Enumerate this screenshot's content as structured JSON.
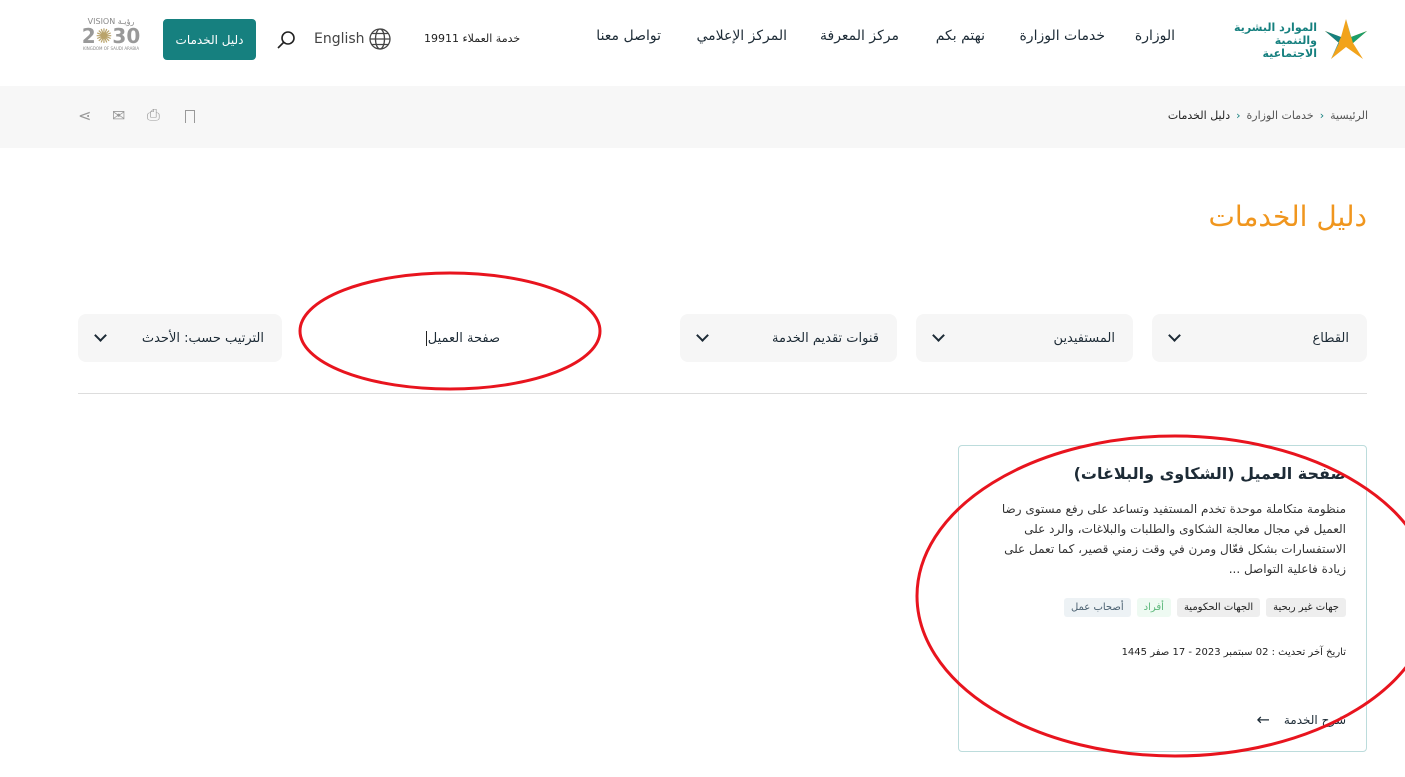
{
  "header": {
    "logo_text": "الموارد البشرية والتنمية الاجتماعية",
    "nav": [
      "الوزارة",
      "خدمات الوزارة",
      "نهتم بكم",
      "مركز المعرفة",
      "المركز الإعلامي",
      "تواصل معنا"
    ],
    "customer_service": "خدمة العملاء 19911",
    "language": "English",
    "services_guide_button": "دليل الخدمات",
    "vision_logo": "VISION 2030 رؤية المملكة العربية السعودية KINGDOM OF SAUDI ARABIA"
  },
  "breadcrumb": [
    "الرئيسية",
    "خدمات الوزارة",
    "دليل الخدمات"
  ],
  "page_title": "دليل الخدمات",
  "filters": {
    "sector": "القطاع",
    "beneficiaries": "المستفيدين",
    "channels": "قنوات تقديم الخدمة",
    "search_value": "صفحة العميل",
    "sort": "الترتيب حسب: الأحدث"
  },
  "card": {
    "title": "صفحة العميل (الشكاوى والبلاغات)",
    "description": "منظومة متكاملة موحدة تخدم المستفيد وتساعد على رفع مستوى رضا العميل في مجال معالجة الشكاوى والطلبات والبلاغات، والرد على الاستفسارات بشكل فعّال ومرن في وقت زمني قصير، كما تعمل على زيادة فاعلية التواصل ...",
    "tags": [
      "جهات غير ربحية",
      "الجهات الحكومية",
      "أفراد",
      "أصحاب عمل"
    ],
    "updated": "تاريخ آخر تحديث : 02 سبتمبر 2023 - 17 صفر 1445",
    "link": "شرح الخدمة"
  },
  "colors": {
    "accent": "#16807f",
    "title": "#f0961e",
    "annotation": "#e8141e"
  }
}
